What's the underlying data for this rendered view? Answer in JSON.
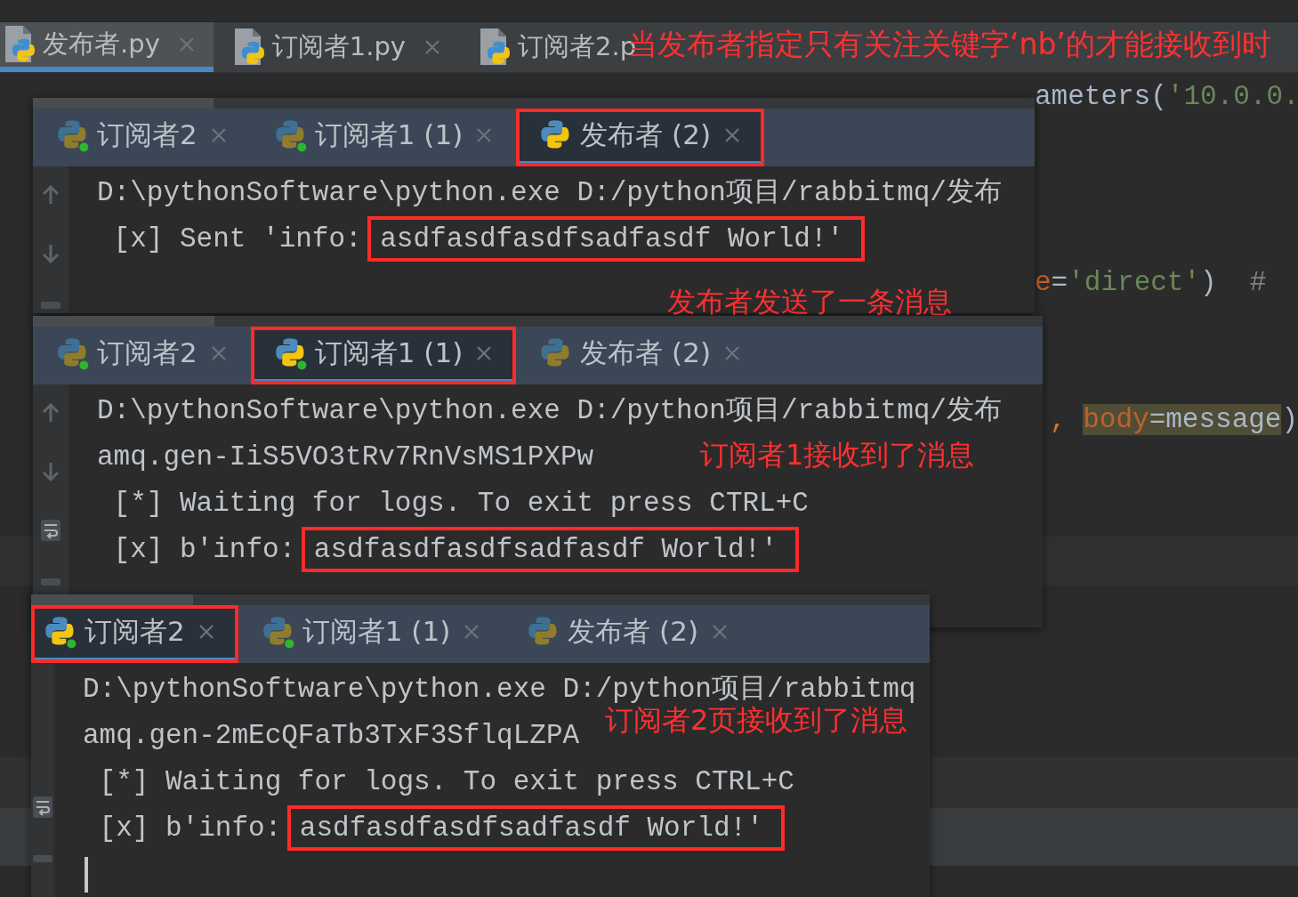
{
  "editor_tabs": [
    {
      "label": "发布者.py",
      "selected": true,
      "close": true
    },
    {
      "label": "订阅者1.py",
      "selected": false,
      "close": true
    },
    {
      "label": "订阅者2.p",
      "selected": false,
      "close": false
    }
  ],
  "editor_note": "当发布者指定只有关注关键字‘nb’的才能接收到时",
  "code_fragments": [
    {
      "tokens": [
        {
          "text": "ameters(",
          "kind": "plain"
        },
        {
          "text": "'10.0.0.",
          "kind": "string"
        }
      ]
    },
    {
      "tokens": [
        {
          "text": "e",
          "kind": "param"
        },
        {
          "text": "=",
          "kind": "plain"
        },
        {
          "text": "'direct'",
          "kind": "string"
        },
        {
          "text": ")  ",
          "kind": "plain"
        },
        {
          "text": "#",
          "kind": "comment"
        }
      ]
    },
    {
      "tokens": [
        {
          "text": ", ",
          "kind": "keyword"
        },
        {
          "text": "body",
          "kind": "param_hl"
        },
        {
          "text": "=message",
          "kind": "plain_hl"
        },
        {
          "text": ")",
          "kind": "plain"
        }
      ]
    }
  ],
  "panels": [
    {
      "tabs": [
        {
          "label": "订阅者2",
          "selected": false,
          "running": true,
          "boxed": false
        },
        {
          "label": "订阅者1 (1)",
          "selected": false,
          "running": true,
          "boxed": false
        },
        {
          "label": "发布者 (2)",
          "selected": true,
          "running": false,
          "boxed": true
        }
      ],
      "lines": [
        {
          "segments": [
            {
              "text": "D:\\pythonSoftware\\python.exe D:/python项目/rabbitmq/发布",
              "boxed": false
            }
          ]
        },
        {
          "segments": [
            {
              "text": " [x] Sent 'info: ",
              "boxed": false
            },
            {
              "text": "asdfasdfasdfsadfasdf World!'",
              "boxed": true
            }
          ]
        }
      ],
      "caret": false,
      "note": "发布者发送了一条消息"
    },
    {
      "tabs": [
        {
          "label": "订阅者2",
          "selected": false,
          "running": true,
          "boxed": false
        },
        {
          "label": "订阅者1 (1)",
          "selected": true,
          "running": true,
          "boxed": true
        },
        {
          "label": "发布者 (2)",
          "selected": false,
          "running": false,
          "boxed": false
        }
      ],
      "lines": [
        {
          "segments": [
            {
              "text": "D:\\pythonSoftware\\python.exe D:/python项目/rabbitmq/发布",
              "boxed": false
            }
          ]
        },
        {
          "segments": [
            {
              "text": "amq.gen-IiS5VO3tRv7RnVsMS1PXPw",
              "boxed": false
            }
          ]
        },
        {
          "segments": [
            {
              "text": " [*] Waiting for logs. To exit press CTRL+C",
              "boxed": false
            }
          ]
        },
        {
          "segments": [
            {
              "text": " [x] b'info: ",
              "boxed": false
            },
            {
              "text": "asdfasdfasdfsadfasdf World!'",
              "boxed": true
            }
          ]
        }
      ],
      "caret": false,
      "note": "订阅者1接收到了消息"
    },
    {
      "tabs": [
        {
          "label": "订阅者2",
          "selected": true,
          "running": true,
          "boxed": true
        },
        {
          "label": "订阅者1 (1)",
          "selected": false,
          "running": true,
          "boxed": false
        },
        {
          "label": "发布者 (2)",
          "selected": false,
          "running": false,
          "boxed": false
        }
      ],
      "lines": [
        {
          "segments": [
            {
              "text": "D:\\pythonSoftware\\python.exe D:/python项目/rabbitmq",
              "boxed": false
            }
          ]
        },
        {
          "segments": [
            {
              "text": "amq.gen-2mEcQFaTb3TxF3SflqLZPA",
              "boxed": false
            }
          ]
        },
        {
          "segments": [
            {
              "text": " [*] Waiting for logs. To exit press CTRL+C",
              "boxed": false
            }
          ]
        },
        {
          "segments": [
            {
              "text": " [x] b'info: ",
              "boxed": false
            },
            {
              "text": "asdfasdfasdfsadfasdf World!'",
              "boxed": true
            }
          ]
        }
      ],
      "caret": true,
      "note": "订阅者2页接收到了消息"
    }
  ]
}
